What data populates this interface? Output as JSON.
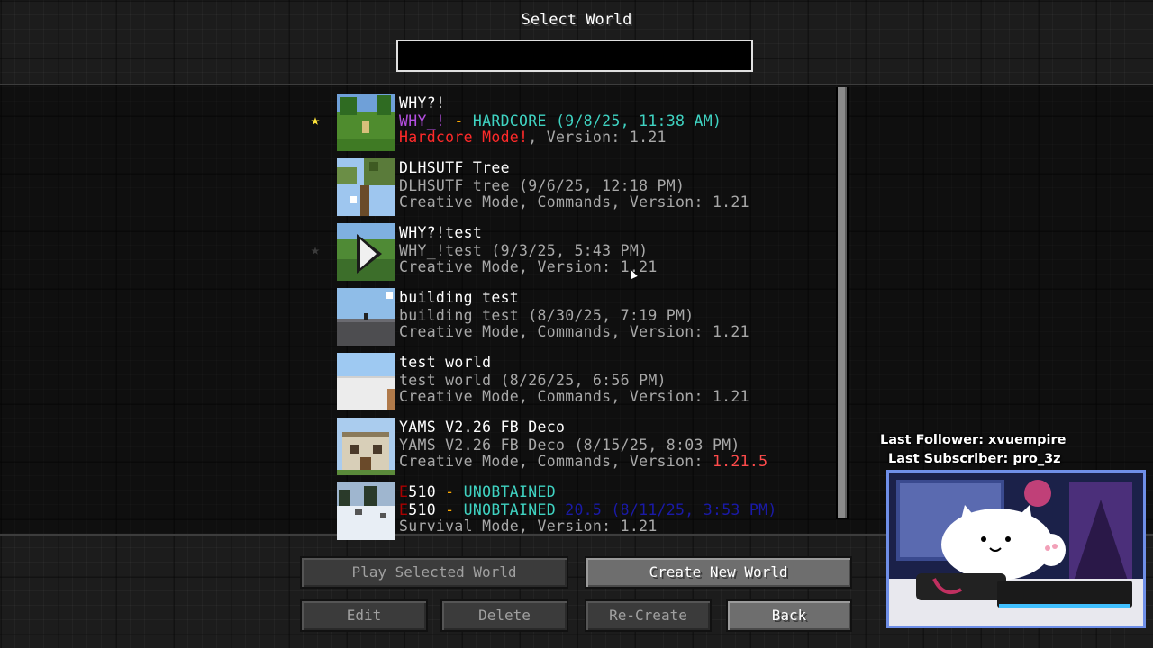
{
  "screen": {
    "title": "Select World",
    "search_value": "_"
  },
  "worlds": [
    {
      "favorite": true,
      "name": "WHY?!",
      "line2": [
        {
          "text": "WHY_!",
          "color": "#b44fe0"
        },
        {
          "text": " - ",
          "color": "#ffaa00"
        },
        {
          "text": "HARDCORE (9/8/25, 11:38 AM)",
          "color": "#3fd3c2"
        }
      ],
      "line3": [
        {
          "text": "Hardcore Mode!",
          "color": "#ff2a2a"
        },
        {
          "text": ", Version: 1.21",
          "color": "#a8a8a8"
        }
      ],
      "thumb": "grass-field"
    },
    {
      "favorite": false,
      "name": "DLHSUTF Tree",
      "line2": [
        {
          "text": "DLHSUTF tree (9/6/25, 12:18 PM)",
          "color": "#a8a8a8"
        }
      ],
      "line3": [
        {
          "text": "Creative Mode, Commands, Version: 1.21",
          "color": "#a8a8a8"
        }
      ],
      "thumb": "tree-sky"
    },
    {
      "favorite": "dim",
      "name": "WHY?!test",
      "line2": [
        {
          "text": "WHY_!test (9/3/25, 5:43 PM)",
          "color": "#a8a8a8"
        }
      ],
      "line3": [
        {
          "text": "Creative Mode, Version: 1.21",
          "color": "#a8a8a8"
        }
      ],
      "thumb": "play-arrow"
    },
    {
      "favorite": false,
      "name": "building test",
      "line2": [
        {
          "text": "building test (8/30/25, 7:19 PM)",
          "color": "#a8a8a8"
        }
      ],
      "line3": [
        {
          "text": "Creative Mode, Commands, Version: 1.21",
          "color": "#a8a8a8"
        }
      ],
      "thumb": "flat-sky"
    },
    {
      "favorite": false,
      "name": "test world",
      "line2": [
        {
          "text": "test world (8/26/25, 6:56 PM)",
          "color": "#a8a8a8"
        }
      ],
      "line3": [
        {
          "text": "Creative Mode, Commands, Version: 1.21",
          "color": "#a8a8a8"
        }
      ],
      "thumb": "white-plain"
    },
    {
      "favorite": false,
      "name": "YAMS V2.26 FB Deco",
      "line2": [
        {
          "text": "YAMS V2.26 FB Deco (8/15/25, 8:03 PM)",
          "color": "#a8a8a8"
        }
      ],
      "line3": [
        {
          "text": "Creative Mode, Commands, Version: ",
          "color": "#a8a8a8"
        },
        {
          "text": "1.21.5",
          "color": "#ff4b4b"
        }
      ],
      "thumb": "building"
    },
    {
      "favorite": false,
      "name_parts": [
        {
          "text": "E",
          "color": "#aa0000"
        },
        {
          "text": "510",
          "color": "#ffffff"
        },
        {
          "text": " - ",
          "color": "#ffaa00"
        },
        {
          "text": "UNOBTAINED",
          "color": "#3fd3c2"
        }
      ],
      "line2": [
        {
          "text": "E",
          "color": "#aa0000"
        },
        {
          "text": "510",
          "color": "#ffffff"
        },
        {
          "text": " - ",
          "color": "#ffaa00"
        },
        {
          "text": "UNOBTAINED",
          "color": "#3fd3c2"
        },
        {
          "text": " 20.5 (8/11/25, 3:53 PM)",
          "color": "#1a1aa8"
        }
      ],
      "line3": [
        {
          "text": "Survival Mode, Version: 1.21",
          "color": "#a8a8a8"
        }
      ],
      "thumb": "snow"
    }
  ],
  "buttons": {
    "play": "Play Selected World",
    "create": "Create New World",
    "edit": "Edit",
    "delete": "Delete",
    "recreate": "Re-Create",
    "back": "Back"
  },
  "overlay": {
    "last_follower": "Last Follower: xvuempire",
    "last_subscriber": "Last Subscriber: pro_3z"
  },
  "colors": {
    "star_active": "#ffe53b",
    "camera_frame": "#6f8fe8"
  }
}
